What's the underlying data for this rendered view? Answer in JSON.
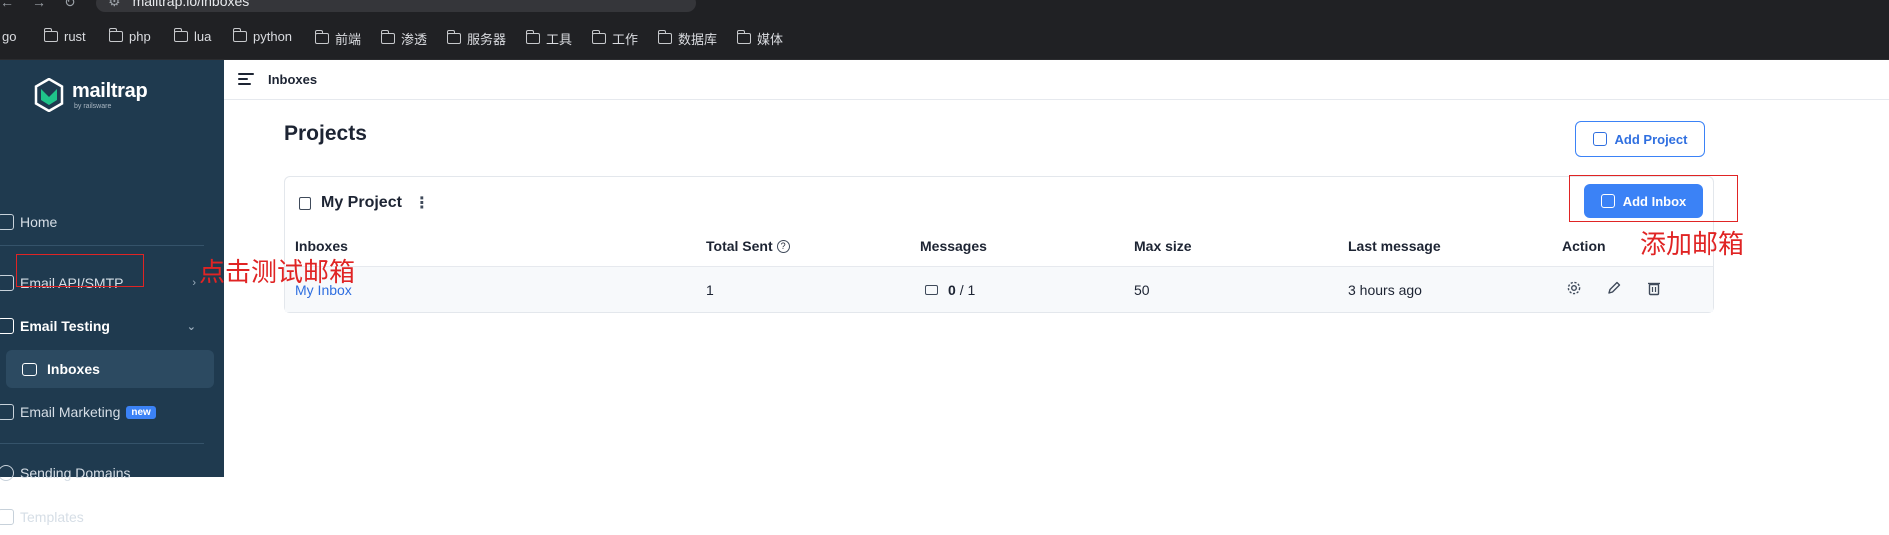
{
  "browser": {
    "url": "mailtrap.io/inboxes",
    "bookmarks": [
      "go",
      "rust",
      "php",
      "lua",
      "python",
      "前端",
      "渗透",
      "服务器",
      "工具",
      "工作",
      "数据库",
      "媒体"
    ]
  },
  "sidebar": {
    "brand": "mailtrap",
    "brand_sub": "by railsware",
    "items": {
      "home": "Home",
      "email_api": "Email API/SMTP",
      "email_testing": "Email Testing",
      "inboxes": "Inboxes",
      "email_marketing": "Email Marketing",
      "new_badge": "new",
      "sending_domains": "Sending Domains",
      "templates": "Templates"
    }
  },
  "header": {
    "breadcrumb": "Inboxes"
  },
  "main": {
    "title": "Projects",
    "add_project": "Add Project",
    "project": {
      "name": "My Project",
      "add_inbox": "Add Inbox",
      "columns": {
        "inboxes": "Inboxes",
        "total_sent": "Total Sent",
        "messages": "Messages",
        "max_size": "Max size",
        "last_message": "Last message",
        "action": "Action"
      },
      "row": {
        "inbox": "My Inbox",
        "total_sent": "1",
        "messages_unread": "0",
        "messages_total": "/ 1",
        "max_size": "50",
        "last_message": "3 hours ago"
      }
    }
  },
  "annotations": {
    "click_testing": "点击测试邮箱",
    "add_inbox_note": "添加邮箱"
  },
  "colors": {
    "sidebar": "#1f3a4f",
    "accent": "#3b82f6",
    "annotation": "#e02424"
  }
}
